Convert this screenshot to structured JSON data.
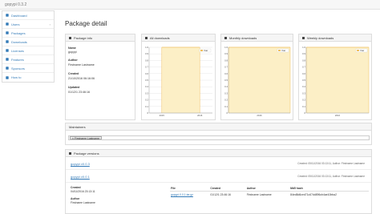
{
  "app": {
    "brand": "gopypi 0.3.2"
  },
  "sidebar": {
    "items": [
      {
        "label": "Dashboard",
        "icon": "dashboard-icon",
        "chevron": ""
      },
      {
        "label": "Users",
        "icon": "users-icon",
        "chevron": "›"
      },
      {
        "label": "Packages",
        "icon": "box-icon",
        "chevron": ""
      },
      {
        "label": "Downloads",
        "icon": "download-icon",
        "chevron": ""
      },
      {
        "label": "Licenses",
        "icon": "license-icon",
        "chevron": ""
      },
      {
        "label": "Features",
        "icon": "features-icon",
        "chevron": ""
      },
      {
        "label": "Sponsors",
        "icon": "sponsors-icon",
        "chevron": ""
      },
      {
        "label": "How to",
        "icon": "help-icon",
        "chevron": ""
      }
    ]
  },
  "page": {
    "title": "Package detail"
  },
  "package_info": {
    "heading": "Package info",
    "name_label": "Name",
    "name_value": "gopypi",
    "author_label": "Author",
    "author_value": "Firstname Lastname",
    "created_label": "Created",
    "created_value": "21/10/2016 06:16:06",
    "updated_label": "Updated",
    "updated_value": "01/12/1 23:46:16"
  },
  "charts": {
    "all": {
      "heading": "All downloads",
      "legend": "Year",
      "y_ticks": [
        "1.0",
        "0.9",
        "0.8",
        "0.7",
        "0.6",
        "0.5",
        "0.4",
        "0.3",
        "0.2",
        "0.1",
        "0"
      ],
      "x_ticks": [
        "2015",
        "2016"
      ]
    },
    "monthly": {
      "heading": "Monthly downloads",
      "legend": "Year",
      "y_ticks": [
        "1.0",
        "0.9",
        "0.8",
        "0.7",
        "0.6",
        "0.5",
        "0.4",
        "0.3",
        "0.2",
        "0.1",
        "0"
      ],
      "x_ticks": [
        "2016"
      ]
    },
    "weekly": {
      "heading": "Weekly downloads",
      "legend": "Year",
      "y_ticks": [
        "1.0",
        "0.9",
        "0.8",
        "0.7",
        "0.6",
        "0.5",
        "0.4",
        "0.3",
        "0.2",
        "0.1",
        "0"
      ],
      "x_ticks": [
        "2016"
      ]
    }
  },
  "chart_data": [
    {
      "type": "area",
      "title": "All downloads",
      "x": [
        "2015",
        "2016"
      ],
      "series": [
        {
          "name": "Year",
          "values": [
            1,
            1
          ]
        }
      ],
      "ylim": [
        0,
        1.0
      ]
    },
    {
      "type": "area",
      "title": "Monthly downloads",
      "x": [
        "2016"
      ],
      "series": [
        {
          "name": "Year",
          "values": [
            1
          ]
        }
      ],
      "ylim": [
        0,
        1.0
      ]
    },
    {
      "type": "area",
      "title": "Weekly downloads",
      "x": [
        "2016"
      ],
      "series": [
        {
          "name": "Year",
          "values": [
            1
          ]
        }
      ],
      "ylim": [
        0,
        1.0
      ]
    }
  ],
  "maintainers": {
    "heading": "Maintainers",
    "tag": "× Firstname Lastname"
  },
  "versions": {
    "heading": "Package versions",
    "rows": [
      {
        "link": "gopypi v0.0.3",
        "meta": "Created: 05/11/2016 03:13:11, Author: Firstname Lastname"
      },
      {
        "link": "gopypi v0.0.1",
        "meta": "Created: 05/11/2016 03:13:11, Author: Firstname Lastname"
      }
    ],
    "detail": {
      "created_label": "Created",
      "created_value": "04/11/2016 23:13:11",
      "author_label": "Author",
      "author_value": "Firstname Lastname",
      "table_headers": [
        "File",
        "Created",
        "Author",
        "Md5 hash"
      ],
      "table_row": [
        "gopypi-0.0.1.tar.gz",
        "01/12/1 23:46:16",
        "Firstname Lastname",
        "84ed8d6ced71c67dd896cb4ae10bba2"
      ]
    }
  },
  "colors": {
    "fill": "#fcefc6",
    "line": "#f0c060",
    "link": "#337ab7"
  }
}
